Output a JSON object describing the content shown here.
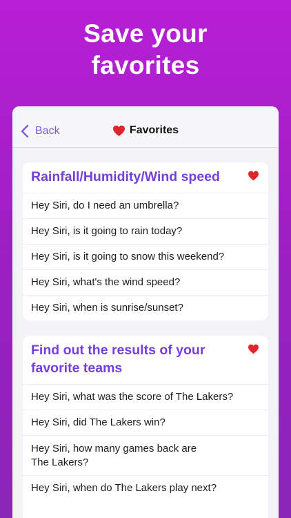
{
  "headline": {
    "line1": "Save your",
    "line2": "favorites"
  },
  "navbar": {
    "back_label": "Back",
    "title": "Favorites",
    "title_icon": "red-heart-icon"
  },
  "colors": {
    "background": "#a61fc9",
    "accent": "#7440db",
    "heart": "#e0262c"
  },
  "sections": [
    {
      "title": "Rainfall/Humidity/Wind speed",
      "favorited": true,
      "items": [
        "Hey Siri, do I need an umbrella?",
        "Hey Siri, is it going to rain today?",
        "Hey Siri, is it going to snow this weekend?",
        "Hey Siri, what's the wind speed?",
        "Hey Siri, when is sunrise/sunset?"
      ]
    },
    {
      "title_line1": "Find out the results of your",
      "title_line2": "favorite teams",
      "favorited": true,
      "items": [
        "Hey Siri, what was the score of The Lakers?",
        "Hey Siri, did The Lakers win?",
        "Hey Siri, how many games back are",
        "The Lakers?",
        "Hey Siri, when do The Lakers play next?"
      ]
    }
  ]
}
